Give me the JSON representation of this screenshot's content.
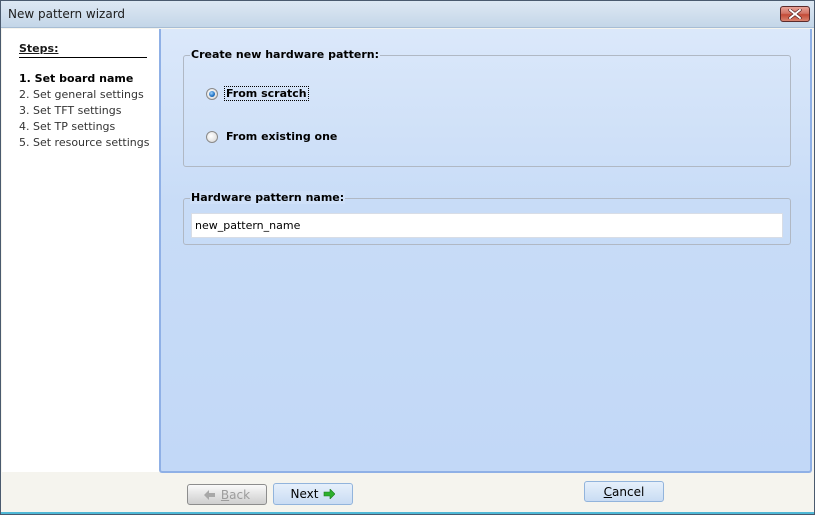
{
  "window": {
    "title": "New pattern wizard",
    "close_icon": "close-icon"
  },
  "sidebar": {
    "steps_title": "Steps:",
    "steps": [
      {
        "label": "1. Set board name",
        "active": true
      },
      {
        "label": "2. Set general settings",
        "active": false
      },
      {
        "label": "3. Set TFT settings",
        "active": false
      },
      {
        "label": "4. Set TP settings",
        "active": false
      },
      {
        "label": "5. Set resource settings",
        "active": false
      }
    ]
  },
  "main": {
    "create_group": {
      "legend": "Create new hardware pattern:",
      "options": [
        {
          "label": "From scratch",
          "checked": true
        },
        {
          "label": "From existing one",
          "checked": false
        }
      ]
    },
    "name_group": {
      "legend": "Hardware pattern name:",
      "value": "new_pattern_name"
    }
  },
  "footer": {
    "back": {
      "mnemonic": "B",
      "rest": "ack",
      "icon": "arrow-left-icon",
      "enabled": false
    },
    "next": {
      "label": "Next",
      "icon": "arrow-right-icon",
      "enabled": true
    },
    "cancel": {
      "mnemonic": "C",
      "rest": "ancel",
      "enabled": true
    }
  },
  "colors": {
    "panel_border": "#8fb0e6",
    "next_arrow": "#2db02d",
    "back_arrow": "#a8a8a8",
    "radio_selected": "#1b6fc2"
  }
}
